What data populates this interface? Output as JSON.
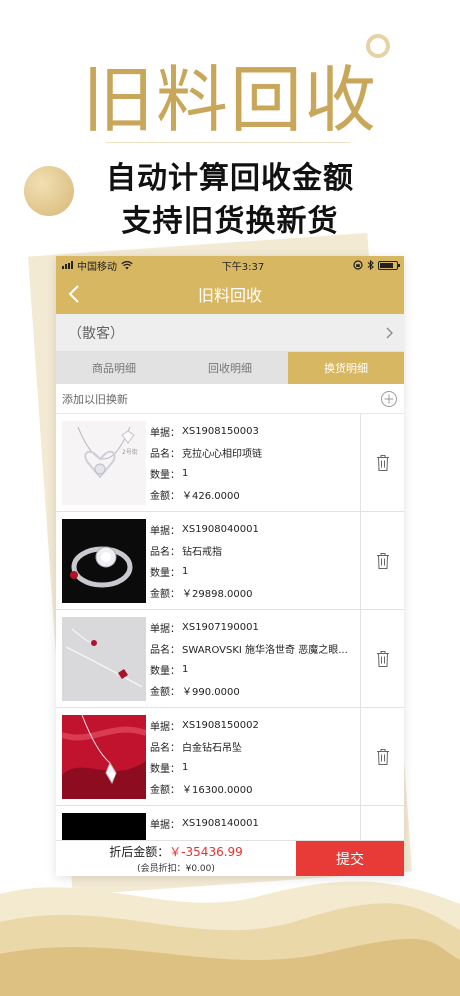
{
  "promo": {
    "title": "旧料回收",
    "line1": "自动计算回收金额",
    "line2": "支持旧货换新货"
  },
  "status": {
    "carrier": "中国移动",
    "time": "下午3:37"
  },
  "nav": {
    "title": "旧料回收"
  },
  "customer": {
    "value": "（散客）"
  },
  "tabs": [
    {
      "label": "商品明细",
      "active": false
    },
    {
      "label": "回收明细",
      "active": false
    },
    {
      "label": "换货明细",
      "active": true
    }
  ],
  "add": {
    "label": "添加以旧换新"
  },
  "fields": {
    "order": "单据：",
    "name": "品名：",
    "qty": "数量：",
    "amount": "金额："
  },
  "items": [
    {
      "order": "XS1908150003",
      "name": "克拉心心相印项链",
      "qty": "1",
      "amount": "￥426.0000",
      "thumb_label": "2号街"
    },
    {
      "order": "XS1908040001",
      "name": "钻石戒指",
      "qty": "1",
      "amount": "￥29898.0000"
    },
    {
      "order": "XS1907190001",
      "name": "SWAROVSKI 施华洛世奇 恶魔之眼...",
      "qty": "1",
      "amount": "￥990.0000"
    },
    {
      "order": "XS1908150002",
      "name": "白金钻石吊坠",
      "qty": "1",
      "amount": "￥16300.0000"
    },
    {
      "order": "XS1908140001",
      "name": "",
      "qty": "",
      "amount": ""
    }
  ],
  "footer": {
    "total_label": "折后金额：",
    "total_value": "￥-35436.99",
    "discount": "(会员折扣：¥0.00)",
    "submit": "提交"
  },
  "colors": {
    "brand_gold": "#d8b762",
    "title_gold": "#c9a75a",
    "submit_red": "#e83a36",
    "amount_red": "#e5322d"
  }
}
